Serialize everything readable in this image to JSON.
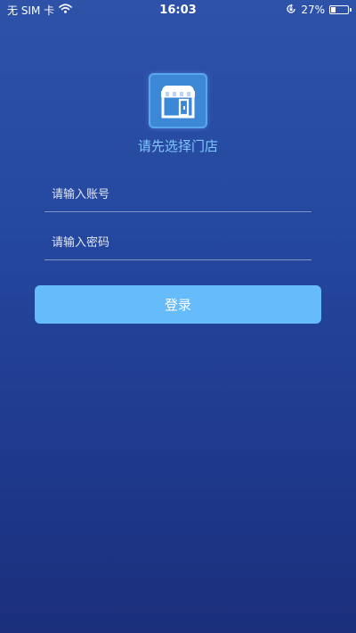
{
  "status_bar": {
    "carrier": "无 SIM 卡",
    "time": "16:03",
    "battery_percent_label": "27%",
    "battery_level": 0.27,
    "icons": [
      "wifi-icon",
      "orientation-lock-icon",
      "battery-icon"
    ]
  },
  "store": {
    "icon": "storefront-icon",
    "label": "请先选择门店"
  },
  "login_form": {
    "account_placeholder": "请输入账号",
    "account_value": "",
    "password_placeholder": "请输入密码",
    "password_value": "",
    "submit_label": "登录"
  },
  "colors": {
    "background_top": "#2e52a8",
    "background_bottom": "#1b2f7c",
    "accent": "#66bbfb",
    "store_label": "#7ec6ff",
    "icon_tile": "#3c87d6"
  }
}
